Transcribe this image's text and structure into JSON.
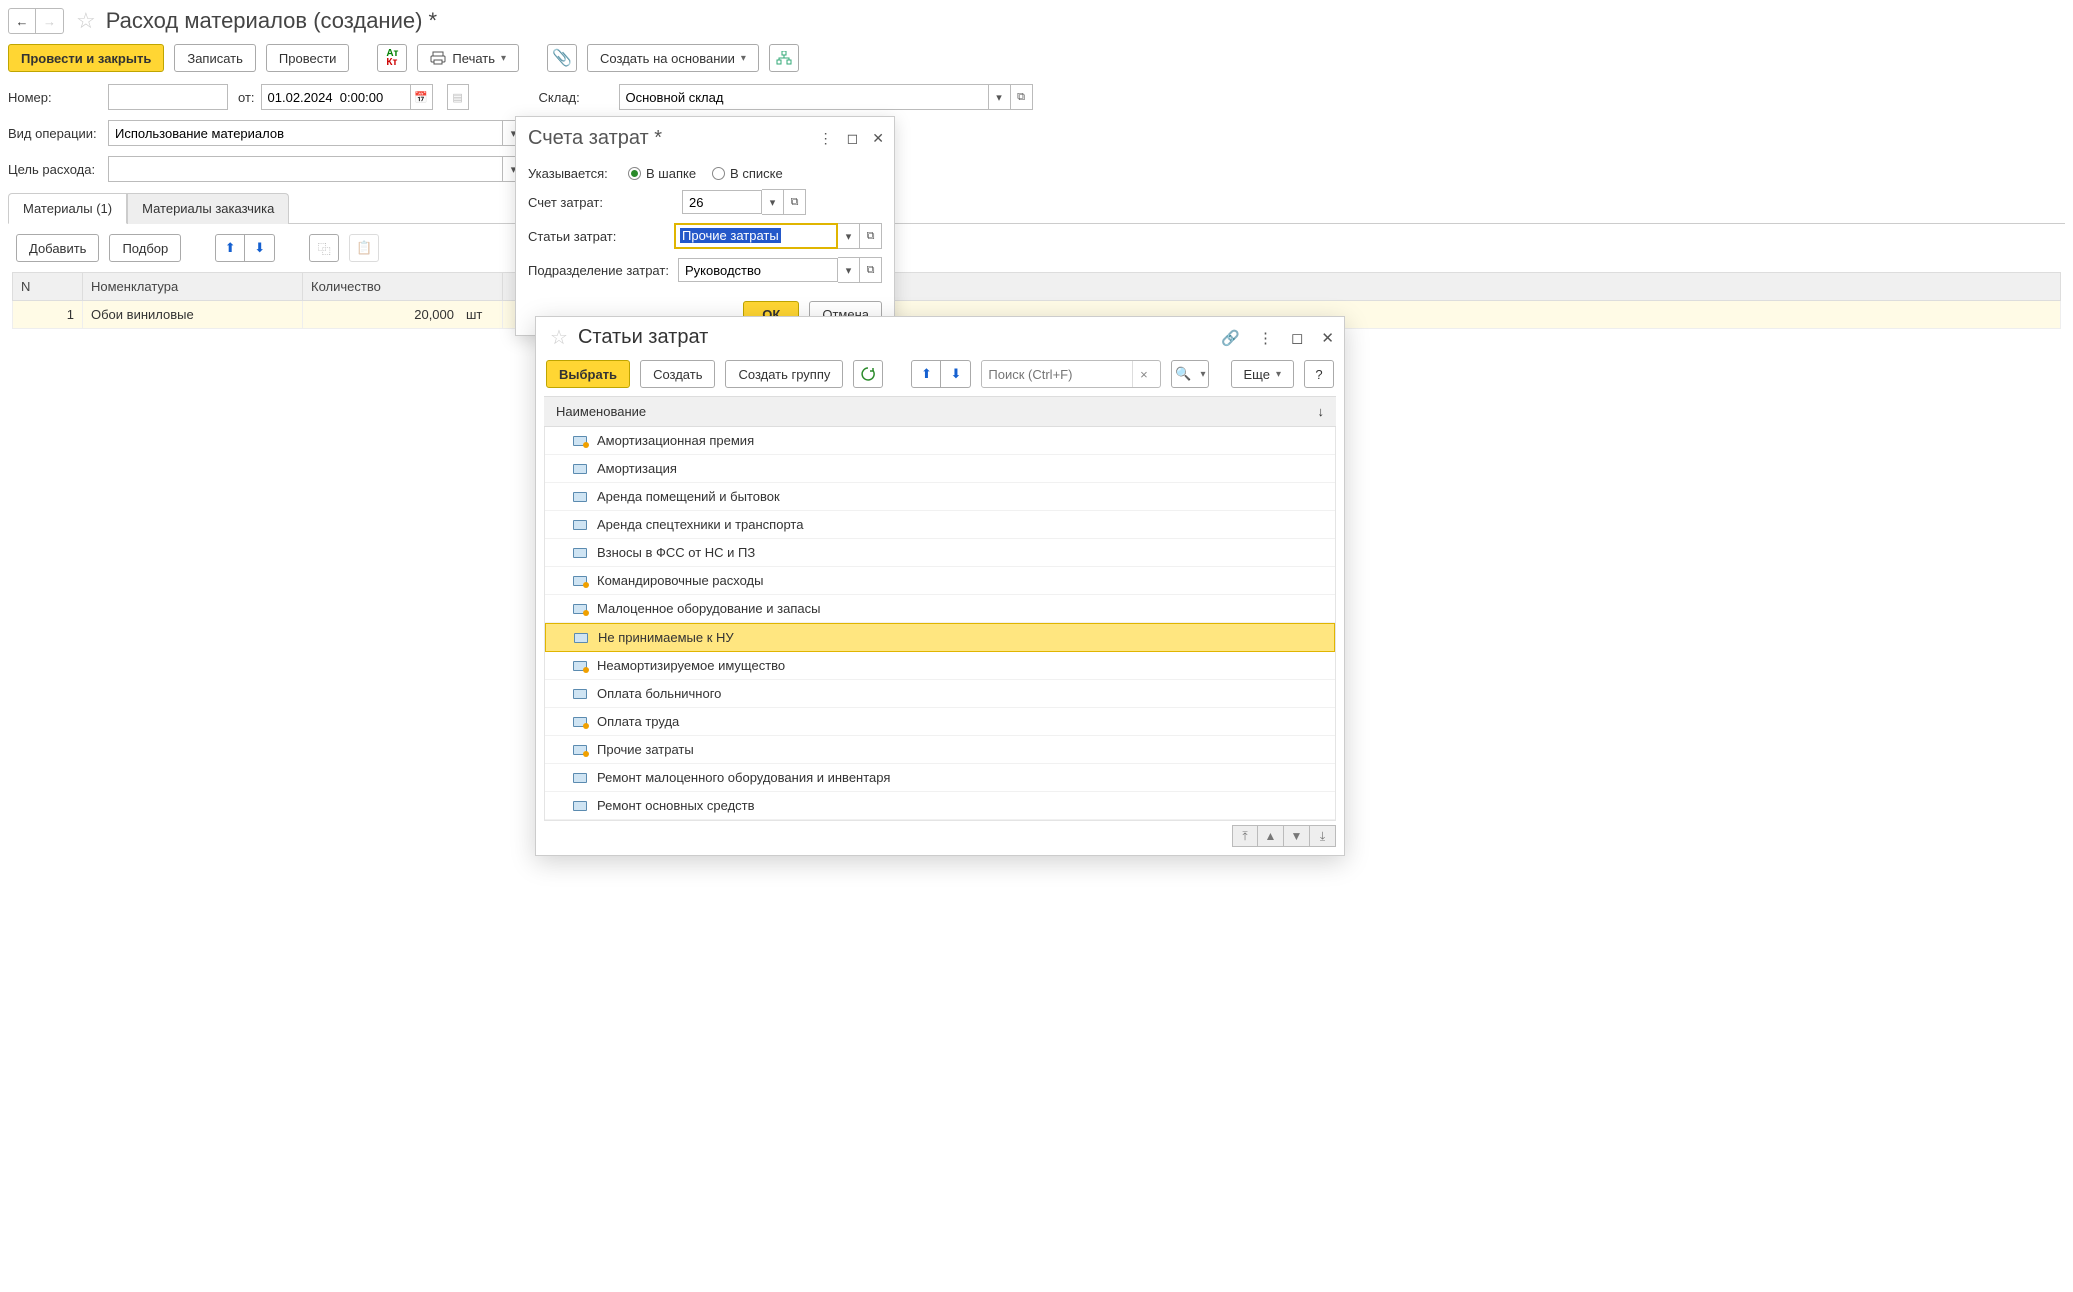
{
  "header": {
    "title": "Расход материалов (создание) *"
  },
  "toolbar": {
    "post_close": "Провести и закрыть",
    "save": "Записать",
    "post": "Провести",
    "print": "Печать",
    "create_based": "Создать на основании"
  },
  "form": {
    "number_label": "Номер:",
    "number_value": "",
    "from_label": "от:",
    "date_value": "01.02.2024  0:00:00",
    "warehouse_label": "Склад:",
    "warehouse_value": "Основной склад",
    "op_type_label": "Вид операции:",
    "op_type_value": "Использование материалов",
    "purpose_label": "Цель расхода:",
    "purpose_value": ""
  },
  "tabs": {
    "t1": "Материалы (1)",
    "t2": "Материалы заказчика"
  },
  "subbar": {
    "add": "Добавить",
    "pick": "Подбор"
  },
  "grid": {
    "cols": {
      "n": "N",
      "nomen": "Номенклатура",
      "qty": "Количество"
    },
    "rows": [
      {
        "n": "1",
        "nomen": "Обои виниловые",
        "qty": "20,000",
        "unit": "шт"
      }
    ]
  },
  "dlg1": {
    "title": "Счета затрат *",
    "spec_label": "Указывается:",
    "radio_header": "В шапке",
    "radio_list": "В списке",
    "account_label": "Счет затрат:",
    "account_value": "26",
    "articles_label": "Статьи затрат:",
    "articles_value": "Прочие затраты",
    "dept_label": "Подразделение затрат:",
    "dept_value": "Руководство",
    "ok": "ОК",
    "cancel": "Отмена"
  },
  "dlg2": {
    "title": "Статьи затрат",
    "select": "Выбрать",
    "create": "Создать",
    "create_group": "Создать группу",
    "search_ph": "Поиск (Ctrl+F)",
    "more": "Еще",
    "help": "?",
    "col_name": "Наименование",
    "sort_icon": "↓",
    "items": [
      {
        "t": "Амортизационная премия",
        "d": true
      },
      {
        "t": "Амортизация",
        "d": false
      },
      {
        "t": "Аренда помещений и бытовок",
        "d": false
      },
      {
        "t": "Аренда спецтехники и транспорта",
        "d": false
      },
      {
        "t": "Взносы в ФСС от НС и ПЗ",
        "d": false
      },
      {
        "t": "Командировочные расходы",
        "d": true
      },
      {
        "t": "Малоценное оборудование и запасы",
        "d": true
      },
      {
        "t": "Не принимаемые к НУ",
        "d": false,
        "sel": true
      },
      {
        "t": "Неамортизируемое имущество",
        "d": true
      },
      {
        "t": "Оплата больничного",
        "d": false
      },
      {
        "t": "Оплата труда",
        "d": true
      },
      {
        "t": "Прочие затраты",
        "d": true
      },
      {
        "t": "Ремонт малоценного оборудования и инвентаря",
        "d": false
      },
      {
        "t": "Ремонт основных средств",
        "d": false
      }
    ]
  }
}
